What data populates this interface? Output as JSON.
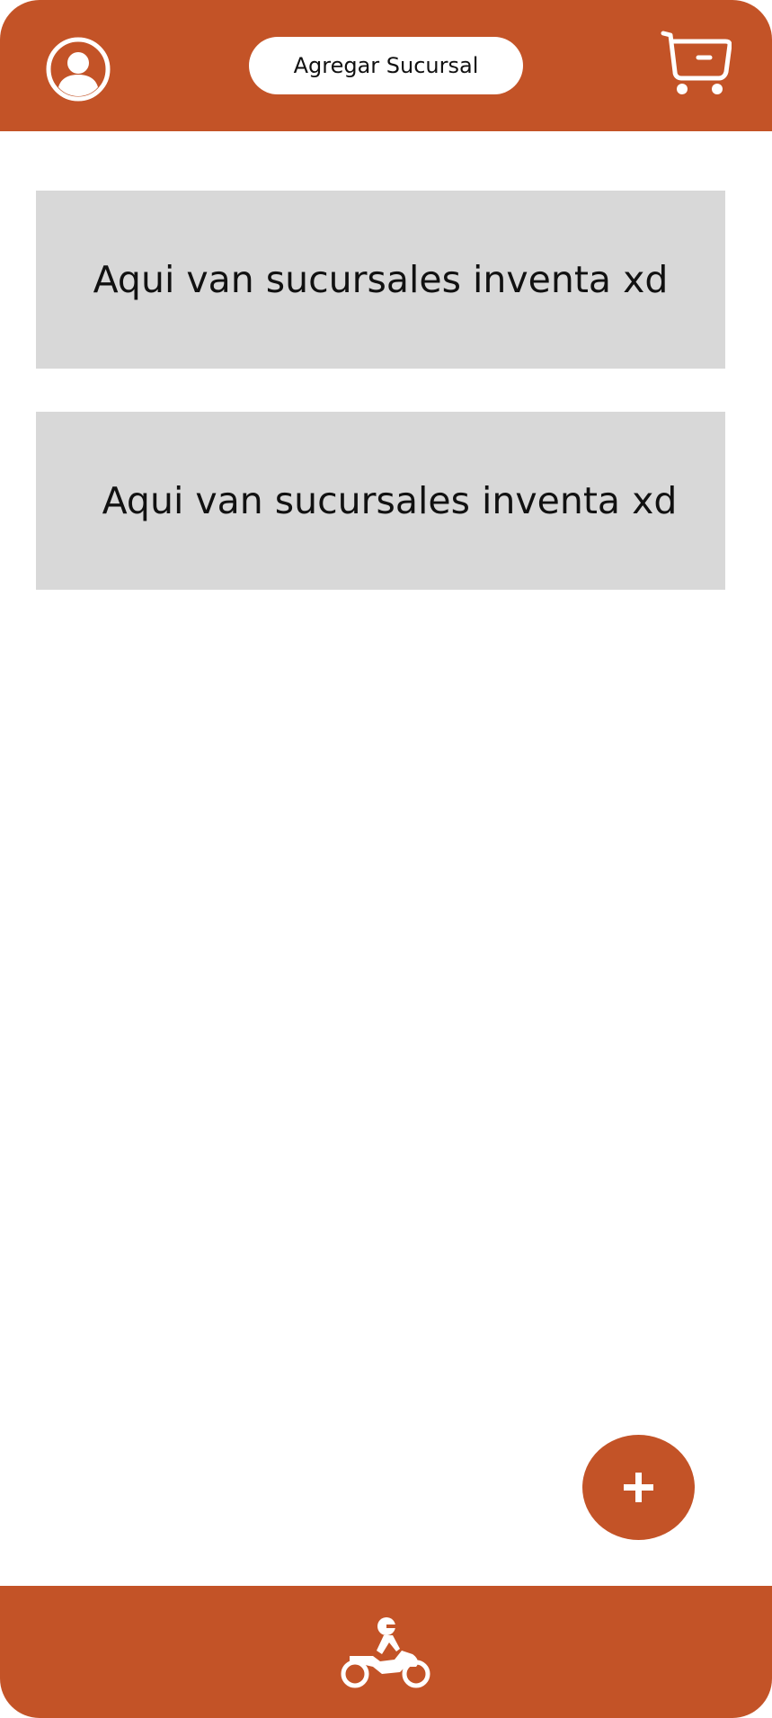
{
  "colors": {
    "brand": "#c35327",
    "card_background": "#d8d8d8",
    "background": "#ffffff"
  },
  "header": {
    "profile_icon": "user-circle-icon",
    "add_branch_label": "Agregar Sucursal",
    "cart_icon": "shopping-cart-icon"
  },
  "branches": [
    {
      "label": "Aqui van sucursales inventa xd"
    },
    {
      "label": "Aqui van sucursales inventa xd"
    }
  ],
  "fab": {
    "icon": "plus-icon"
  },
  "footer": {
    "icon": "delivery-motorcycle-icon"
  }
}
